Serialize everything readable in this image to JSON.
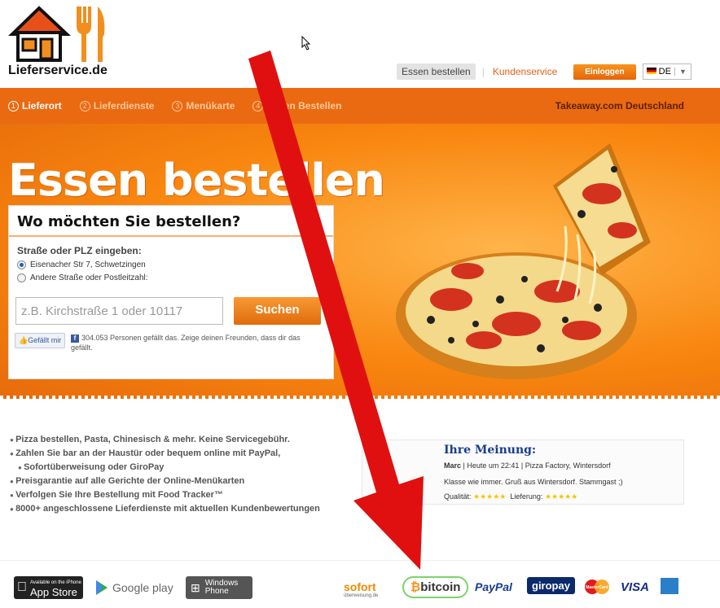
{
  "logo": {
    "name": "Lieferservice.de",
    "icon": "house-cutlery-icon"
  },
  "topnav": {
    "order": "Essen bestellen",
    "service": "Kundenservice",
    "login": "Einloggen",
    "lang": "DE"
  },
  "steps": [
    {
      "num": "1",
      "label": "Lieferort"
    },
    {
      "num": "2",
      "label": "Lieferdienste"
    },
    {
      "num": "3",
      "label": "Menükarte"
    },
    {
      "num": "4",
      "label": "Essen Bestellen"
    }
  ],
  "brand": "Takeaway.com Deutschland",
  "hero": {
    "title": "Essen bestellen"
  },
  "search": {
    "heading": "Wo möchten Sie bestellen?",
    "label": "Straße oder PLZ eingeben:",
    "option1": "Eisenacher Str 7, Schwetzingen",
    "option2": "Andere Straße oder Postleitzahl:",
    "placeholder": "z.B. Kirchstraße 1 oder 10117",
    "button": "Suchen"
  },
  "facebook": {
    "like": "Gefällt mir",
    "text": "304.053 Personen gefällt das. Zeige deinen Freunden, dass dir das gefällt."
  },
  "features": [
    "Pizza bestellen, Pasta, Chinesisch & mehr. Keine Servicegebühr.",
    "Zahlen Sie bar an der Haustür oder bequem online mit PayPal,",
    "Sofortüberweisung oder GiroPay",
    "Preisgarantie auf alle Gerichte der Online-Menükarten",
    "Verfolgen Sie Ihre Bestellung mit Food Tracker™",
    "8000+ angeschlossene Lieferdienste mit aktuellen Kundenbewertungen"
  ],
  "opinion": {
    "title": "Ihre Meinung:",
    "author": "Marc",
    "meta": " | Heute um 22:41 | Pizza Factory, Wintersdorf",
    "text": "Klasse wie immer. Gruß aus Wintersdorf. Stammgast ;)",
    "quality": "Qualität:",
    "delivery": "Lieferung:",
    "stars": "★★★★★"
  },
  "stores": {
    "appstore_small": "Available on the iPhone",
    "appstore": "App Store",
    "googleplay": "Google play",
    "winphone": "Windows Phone"
  },
  "payments": {
    "sofort": "sofort",
    "sofort_sub": "überweisung.de",
    "bitcoin": "bitcoin",
    "paypal": "PayPal",
    "giropay": "giropay",
    "mastercard": "MasterCard",
    "visa": "VISA"
  },
  "colors": {
    "orange": "#ea6a12",
    "arrow": "#e01010",
    "highlight": "#7bd36a"
  }
}
